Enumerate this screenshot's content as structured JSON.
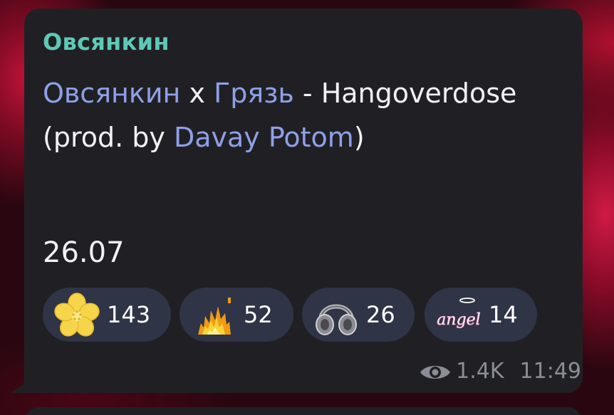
{
  "message": {
    "sender": "Овсянкин",
    "title_parts": [
      {
        "text": "Овсянкин",
        "link": true
      },
      {
        "text": " x ",
        "link": false
      },
      {
        "text": "Грязь",
        "link": true
      },
      {
        "text": " - Hangoverdose (prod. by ",
        "link": false
      },
      {
        "text": "Davay Potom",
        "link": true
      },
      {
        "text": ")",
        "link": false
      }
    ],
    "date_text": "26.07",
    "reactions": [
      {
        "icon": "sakura-flower-icon",
        "count": "143"
      },
      {
        "icon": "fire-icon",
        "count": "52"
      },
      {
        "icon": "headphones-icon",
        "count": "26"
      },
      {
        "icon": "angel-text-icon",
        "icon_text": "angel",
        "count": "14"
      }
    ],
    "views": "1.4K",
    "time": "11:49"
  },
  "colors": {
    "bubble": "#202024",
    "sender": "#5ec9b7",
    "link": "#8fa0e8",
    "text": "#f2f2f4",
    "reaction_bg": "#2f3446",
    "meta": "#8b8d96"
  }
}
